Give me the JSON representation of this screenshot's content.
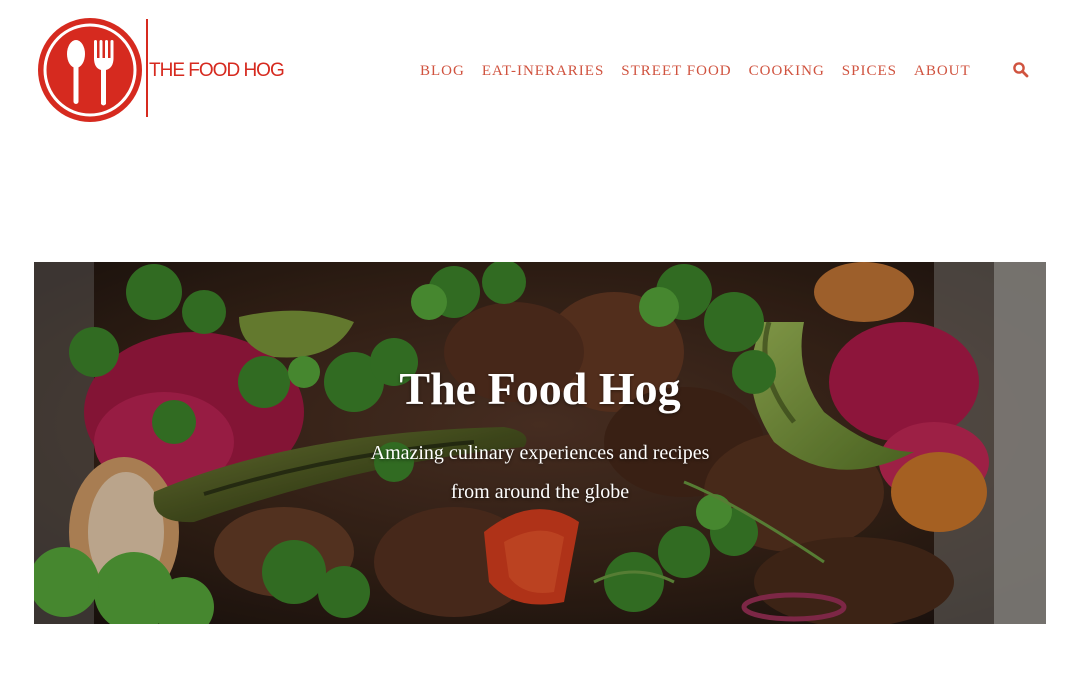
{
  "brand": {
    "logo_text": "THE FOOD HOG",
    "logo_icon": "spoon-fork-icon",
    "color": "#d62a1f"
  },
  "nav": {
    "items": [
      {
        "label": "BLOG"
      },
      {
        "label": "EAT-INERARIES"
      },
      {
        "label": "STREET FOOD"
      },
      {
        "label": "COOKING"
      },
      {
        "label": "SPICES"
      },
      {
        "label": "ABOUT"
      }
    ],
    "search_icon": "search-icon",
    "color": "#d0533f"
  },
  "hero": {
    "title": "The Food Hog",
    "subtitle_line1": "Amazing culinary experiences and recipes",
    "subtitle_line2": "from around the globe"
  }
}
